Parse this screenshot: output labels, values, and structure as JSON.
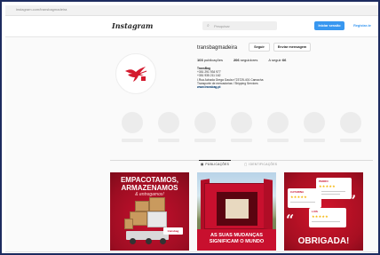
{
  "browser": {
    "url": "instagram.com/transbagmadeira"
  },
  "topbar": {
    "logo": "Instagram",
    "search_placeholder": "Pesquisar",
    "login_label": "Iniciar sessão",
    "signup_label": "Registar-te"
  },
  "profile": {
    "username": "transbagmadeira",
    "follow_label": "Seguir",
    "message_label": "Enviar mensagem",
    "stats": {
      "posts_count": "103",
      "posts_label": "publicações",
      "followers_count": "206",
      "followers_label": "seguidores",
      "following_label": "A seguir",
      "following_count": "66"
    },
    "bio": {
      "name": "TransBag",
      "line1": "+351 291 934 977",
      "line2": "+351 935 211 162",
      "line3": "I.Rua Achada Grega Gaula n°23725-401 Camacha",
      "line4": "Transporte de mercadorias / Shipping Services",
      "link": "www.transbag.pt"
    }
  },
  "tabs": {
    "posts": "PUBLICAÇÕES",
    "tagged": "IDENTIFICAÇÕES"
  },
  "posts": [
    {
      "title": "EMPACOTAMOS, ARMAZENAMOS",
      "subtitle": "& entregamos!",
      "brand": "transbag"
    },
    {
      "caption": "AS SUAS MUDANÇAS SIGNIFICAM O MUNDO"
    },
    {
      "reviewers": [
        "PEDRO",
        "CATARINA",
        "LUIS"
      ],
      "caption": "OBRIGADA!"
    }
  ],
  "colors": {
    "accent": "#3897f0",
    "brand_red": "#c8102e"
  }
}
